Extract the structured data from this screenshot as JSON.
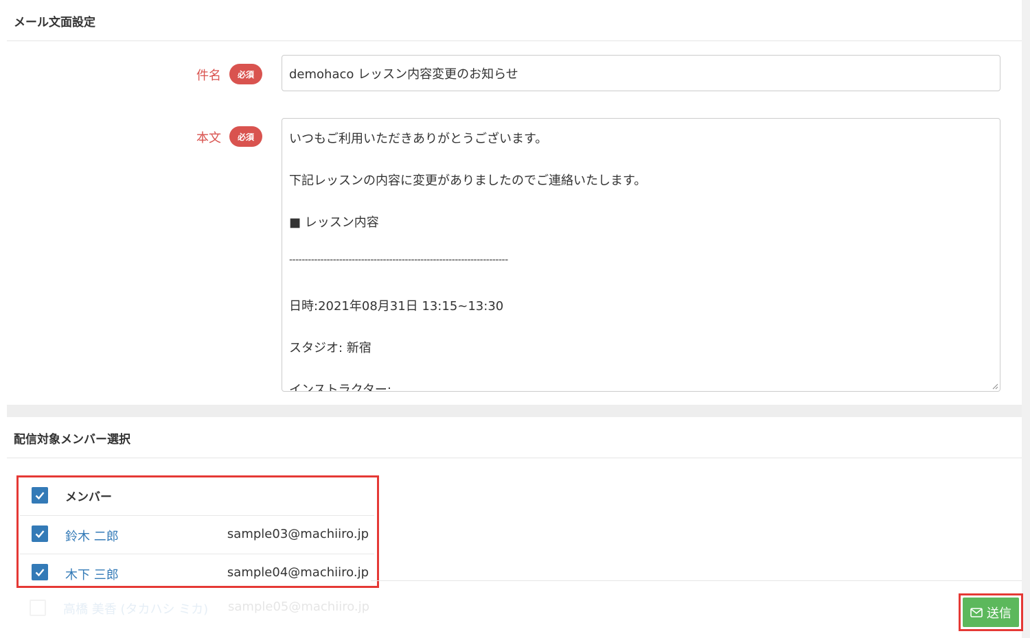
{
  "mail_settings": {
    "section_title": "メール文面設定",
    "subject_label": "件名",
    "body_label": "本文",
    "required_badge": "必須",
    "subject_value": "demohaco レッスン内容変更のお知らせ",
    "body_lines": [
      "いつもご利用いただきありがとうございます。",
      "下記レッスンの内容に変更がありましたのでご連絡いたします。",
      "■ レッスン内容",
      "----------------------------------------------------------------------",
      "日時:2021年08月31日 13:15~13:30",
      "スタジオ: 新宿",
      "インストラクター:"
    ]
  },
  "members": {
    "section_title": "配信対象メンバー選択",
    "header_label": "メンバー",
    "rows": [
      {
        "name": "鈴木 二郎",
        "email": "sample03@machiiro.jp",
        "checked": true
      },
      {
        "name": "木下 三郎",
        "email": "sample04@machiiro.jp",
        "checked": true
      }
    ],
    "faded_row": {
      "name": "高橋 美香 (タカハシ ミカ)",
      "email": "sample05@machiiro.jp",
      "checked": false
    }
  },
  "actions": {
    "send_label": "送信",
    "send_icon": "envelope-icon"
  },
  "colors": {
    "required": "#d9534f",
    "link": "#337ab7",
    "checkbox": "#337ab7",
    "send": "#5cb85c",
    "highlight": "#e53935"
  }
}
